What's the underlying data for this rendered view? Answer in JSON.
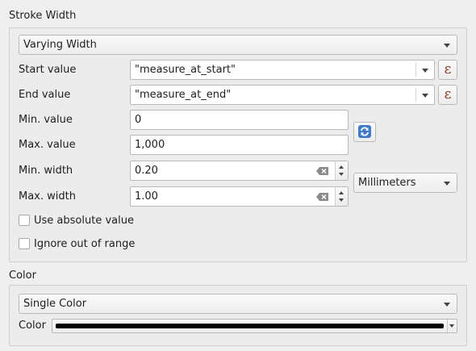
{
  "stroke_width": {
    "title": "Stroke Width",
    "mode": "Varying Width",
    "start_value": {
      "label": "Start value",
      "value": "\"measure_at_start\""
    },
    "end_value": {
      "label": "End value",
      "value": "\"measure_at_end\""
    },
    "min_value": {
      "label": "Min. value",
      "value": "0"
    },
    "max_value": {
      "label": "Max. value",
      "value": "1,000"
    },
    "min_width": {
      "label": "Min. width",
      "value": "0.20"
    },
    "max_width": {
      "label": "Max. width",
      "value": "1.00"
    },
    "unit": "Millimeters",
    "use_absolute": {
      "label": "Use absolute value",
      "checked": false
    },
    "ignore_out_of_range": {
      "label": "Ignore out of range",
      "checked": false
    },
    "expression_icon": "ε"
  },
  "color": {
    "title": "Color",
    "mode": "Single Color",
    "label": "Color",
    "value": "#000000"
  },
  "icons": {
    "expression": "expression-icon",
    "refresh": "refresh-icon",
    "clear": "clear-icon",
    "dropdown": "chevron-down-icon"
  }
}
